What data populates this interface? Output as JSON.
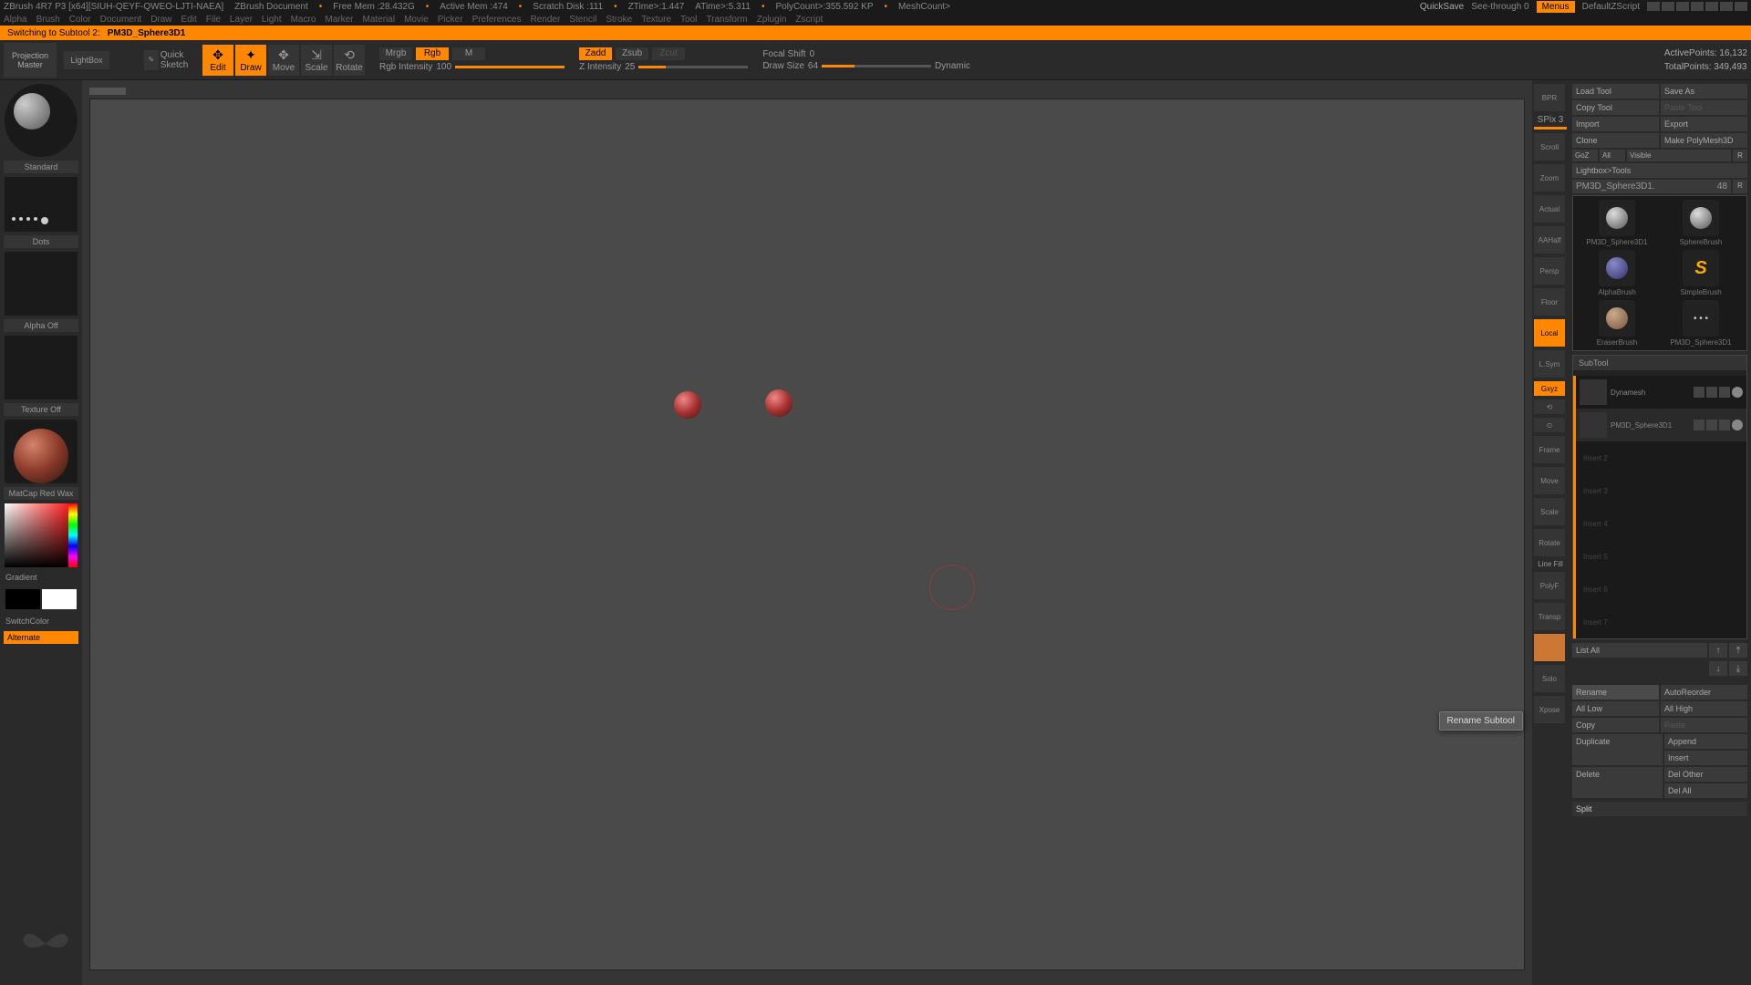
{
  "titlebar": {
    "app": "ZBrush 4R7 P3 [x64][SIUH-QEYF-QWEO-LJTI-NAEA]",
    "doc": "ZBrush Document",
    "freemem": "Free Mem :28.432G",
    "activemem": "Active Mem :474",
    "scratch": "Scratch Disk :111",
    "ztime1": "ZTime>:1.447",
    "ztime2": "ATime>:5.311",
    "polycount": "PolyCount>:355.592 KP",
    "meshcount": "MeshCount>",
    "quicksave": "QuickSave",
    "seethrough": "See-through   0",
    "menus": "Menus",
    "script": "DefaultZScript"
  },
  "menubar": [
    "Alpha",
    "Brush",
    "Color",
    "Document",
    "Draw",
    "Edit",
    "File",
    "Layer",
    "Light",
    "Macro",
    "Marker",
    "Material",
    "Movie",
    "Picker",
    "Preferences",
    "Render",
    "Stencil",
    "Stroke",
    "Texture",
    "Tool",
    "Transform",
    "Zplugin",
    "Zscript"
  ],
  "status": {
    "msg": "Switching to Subtool 2:",
    "name": "PM3D_Sphere3D1"
  },
  "toolbar": {
    "projection": "Projection Master",
    "lightbox": "LightBox",
    "quicksketch": "Quick Sketch",
    "modes": {
      "edit": "Edit",
      "draw": "Draw",
      "move": "Move",
      "scale": "Scale",
      "rotate": "Rotate"
    },
    "colormode": {
      "mrgb": "Mrgb",
      "rgb": "Rgb",
      "m": "M"
    },
    "zmode": {
      "zadd": "Zadd",
      "zsub": "Zsub",
      "zcut": "Zcut"
    },
    "rgb_intensity_label": "Rgb Intensity",
    "rgb_intensity_val": "100",
    "z_intensity_label": "Z Intensity",
    "z_intensity_val": "25",
    "focal_label": "Focal Shift",
    "focal_val": "0",
    "draw_label": "Draw Size",
    "draw_val": "64",
    "dynamic": "Dynamic",
    "activepoints_label": "ActivePoints:",
    "activepoints_val": "16,132",
    "totalpoints_label": "TotalPoints:",
    "totalpoints_val": "349,493"
  },
  "left": {
    "brush": "Standard",
    "stroke": "Dots",
    "alpha": "Alpha  Off",
    "texture": "Texture  Off",
    "material": "MatCap Red Wax",
    "gradient": "Gradient",
    "switchcolor": "SwitchColor",
    "alternate": "Alternate"
  },
  "rightnav": {
    "spix_label": "SPix",
    "spix_val": "3",
    "items": [
      "BPR",
      "Scroll",
      "Zoom",
      "Actual",
      "AAHalf",
      "Persp",
      "Floor",
      "Local",
      "L.Sym",
      "Gxyz",
      "Frame",
      "Move",
      "Scale",
      "Rotate",
      "PolyF",
      "Transp",
      "Solo",
      "Xpose"
    ],
    "linefill": "Line Fill"
  },
  "rightpanel": {
    "loadtool": "Load Tool",
    "saveas": "Save As",
    "copytool": "Copy Tool",
    "pastetool": "Paste Tool",
    "import": "Import",
    "export": "Export",
    "clone": "Clone",
    "makepoly": "Make PolyMesh3D",
    "goz": "GoZ",
    "all": "All",
    "visible": "Visible",
    "r": "R",
    "lightboxtools": "Lightbox>Tools",
    "toolslider_name": "PM3D_Sphere3D1.",
    "toolslider_val": "48",
    "tools": [
      {
        "name": "PM3D_Sphere3D1",
        "cls": "sphere"
      },
      {
        "name": "SphereBrush",
        "cls": "sphere"
      },
      {
        "name": "AlphaBrush",
        "cls": "brush"
      },
      {
        "name": "SimpleBrush",
        "cls": "s-icon"
      },
      {
        "name": "EraserBrush",
        "cls": "eraser"
      },
      {
        "name": "PM3D_Sphere3D1",
        "cls": "dots-thumb"
      }
    ],
    "subtool_header": "SubTool",
    "subtools": [
      {
        "name": "Dynamesh",
        "selected": false
      },
      {
        "name": "PM3D_Sphere3D1",
        "selected": true
      }
    ],
    "empty_slots": [
      "Insert 2",
      "Insert 3",
      "Insert 4",
      "Insert 5",
      "Insert 6",
      "Insert 7"
    ],
    "listall": "List All",
    "ops": {
      "rename": "Rename",
      "autoreorder": "AutoReorder",
      "alllow": "All Low",
      "allhigh": "All High",
      "copy": "Copy",
      "paste": "Paste",
      "duplicate": "Duplicate",
      "append": "Append",
      "insert": "Insert",
      "delete": "Delete",
      "delother": "Del Other",
      "delall": "Del All",
      "split": "Split"
    }
  },
  "tooltip": "Rename Subtool"
}
